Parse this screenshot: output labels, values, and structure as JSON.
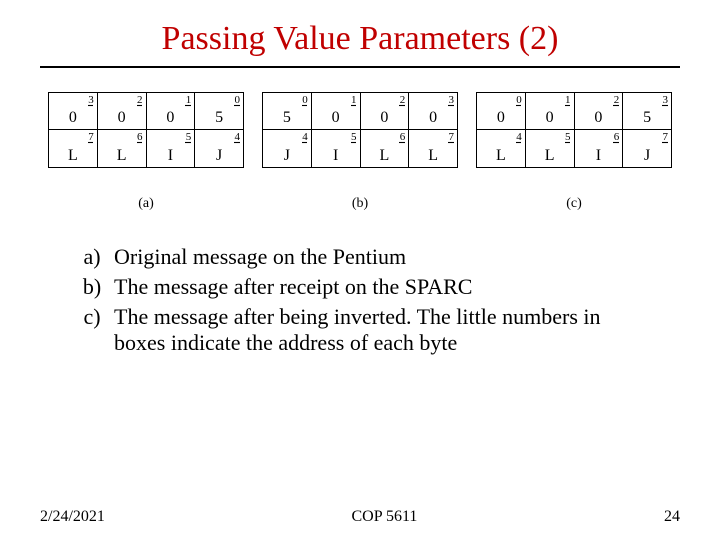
{
  "title": "Passing Value Parameters (2)",
  "panels": {
    "a": {
      "caption": "(a)",
      "rows": [
        [
          {
            "idx": "3",
            "val": "0"
          },
          {
            "idx": "2",
            "val": "0"
          },
          {
            "idx": "1",
            "val": "0"
          },
          {
            "idx": "0",
            "val": "5"
          }
        ],
        [
          {
            "idx": "7",
            "val": "L"
          },
          {
            "idx": "6",
            "val": "L"
          },
          {
            "idx": "5",
            "val": "I"
          },
          {
            "idx": "4",
            "val": "J"
          }
        ]
      ]
    },
    "b": {
      "caption": "(b)",
      "rows": [
        [
          {
            "idx": "0",
            "val": "5"
          },
          {
            "idx": "1",
            "val": "0"
          },
          {
            "idx": "2",
            "val": "0"
          },
          {
            "idx": "3",
            "val": "0"
          }
        ],
        [
          {
            "idx": "4",
            "val": "J"
          },
          {
            "idx": "5",
            "val": "I"
          },
          {
            "idx": "6",
            "val": "L"
          },
          {
            "idx": "7",
            "val": "L"
          }
        ]
      ]
    },
    "c": {
      "caption": "(c)",
      "rows": [
        [
          {
            "idx": "0",
            "val": "0"
          },
          {
            "idx": "1",
            "val": "0"
          },
          {
            "idx": "2",
            "val": "0"
          },
          {
            "idx": "3",
            "val": "5"
          }
        ],
        [
          {
            "idx": "4",
            "val": "L"
          },
          {
            "idx": "5",
            "val": "L"
          },
          {
            "idx": "6",
            "val": "I"
          },
          {
            "idx": "7",
            "val": "J"
          }
        ]
      ]
    }
  },
  "list": [
    {
      "mark": "a)",
      "text": "Original message on the Pentium"
    },
    {
      "mark": "b)",
      "text": "The message after receipt on the SPARC"
    },
    {
      "mark": "c)",
      "text": "The message after being inverted. The little numbers in boxes indicate the address of each byte"
    }
  ],
  "footer": {
    "date": "2/24/2021",
    "course": "COP 5611",
    "page": "24"
  }
}
